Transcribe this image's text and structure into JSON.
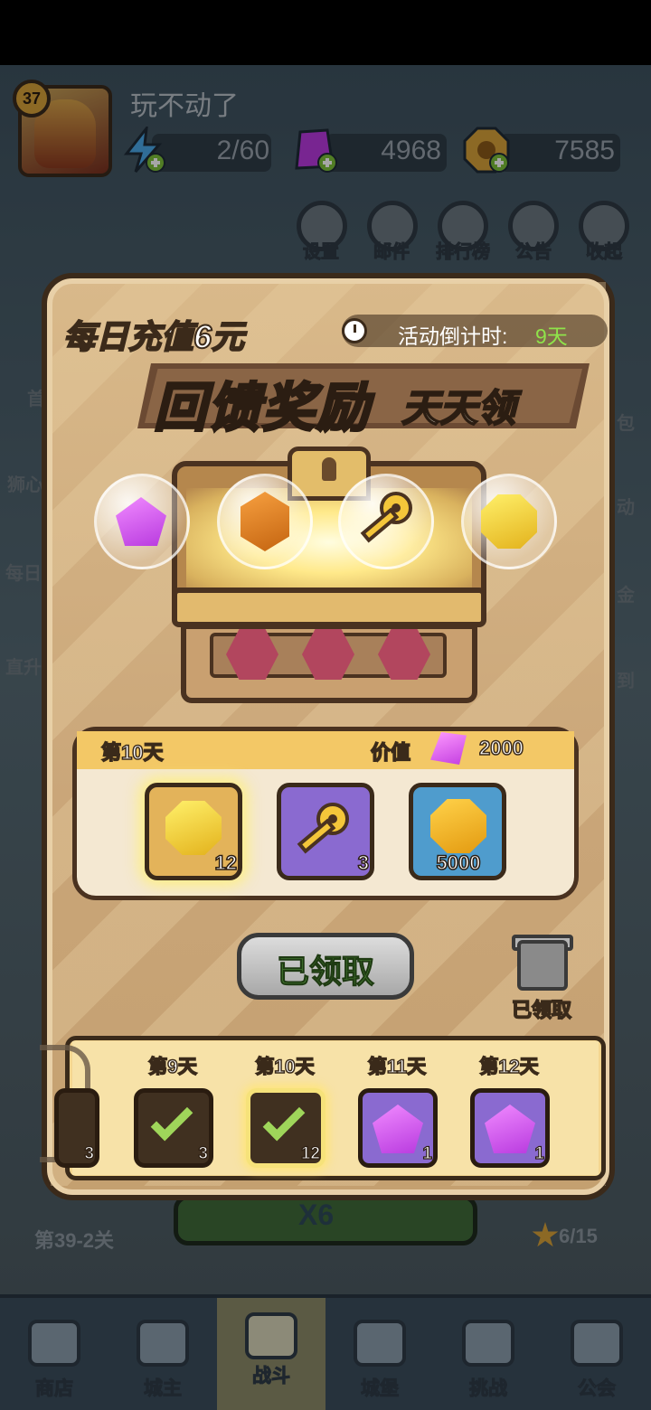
{
  "player": {
    "level": "37",
    "name": "玩不动了"
  },
  "resources": [
    {
      "name": "energy",
      "icon": "lightning-icon",
      "value": "2/60"
    },
    {
      "name": "gems",
      "icon": "purple-gem-icon",
      "value": "4968"
    },
    {
      "name": "coins",
      "icon": "gold-coin-icon",
      "value": "7585"
    }
  ],
  "top_menu": [
    {
      "label": "设置",
      "icon": "gear-icon"
    },
    {
      "label": "邮件",
      "icon": "mail-icon"
    },
    {
      "label": "排行榜",
      "icon": "leaderboard-icon"
    },
    {
      "label": "公告",
      "icon": "megaphone-icon"
    },
    {
      "label": "收起",
      "icon": "collapse-icon"
    }
  ],
  "side_left": [
    "首",
    "狮心",
    "每日",
    "直升"
  ],
  "side_right": [
    "包",
    "动",
    "金",
    "到"
  ],
  "dialog": {
    "daily_title": "每日充值6元",
    "countdown_label": "活动倒计时:",
    "countdown_value": "9天",
    "banner_main": "回馈奖励",
    "banner_sub": "天天领",
    "preview_items": [
      "purple-gem-icon",
      "orange-gem-icon",
      "golden-key-icon",
      "gold-hex-coin-icon"
    ],
    "reward": {
      "day_title": "第10天",
      "value_label": "价值",
      "value_amount": "2000",
      "items": [
        {
          "icon": "gold-hex-coin-icon",
          "count": "12"
        },
        {
          "icon": "golden-key-icon",
          "count": "3"
        },
        {
          "icon": "gold-coin-icon",
          "count": "5000"
        }
      ]
    },
    "claimed_button": "已领取",
    "gift_label": "已领取",
    "days": [
      {
        "label": "第9天",
        "count": "3",
        "state": "claimed"
      },
      {
        "label": "第10天",
        "count": "12",
        "state": "claimed-current"
      },
      {
        "label": "第11天",
        "count": "1",
        "state": "locked"
      },
      {
        "label": "第12天",
        "count": "1",
        "state": "locked"
      }
    ],
    "partial_left_count": "3"
  },
  "stage": {
    "label": "第39-2关",
    "stars": "6/15",
    "battle_multiplier": "X6"
  },
  "navbar": [
    {
      "label": "商店",
      "icon": "shop-icon"
    },
    {
      "label": "城主",
      "icon": "crown-icon"
    },
    {
      "label": "战斗",
      "icon": "crossed-swords-icon",
      "active": true
    },
    {
      "label": "城堡",
      "icon": "castle-icon"
    },
    {
      "label": "挑战",
      "icon": "demon-icon"
    },
    {
      "label": "公会",
      "icon": "guild-banner-icon"
    }
  ]
}
